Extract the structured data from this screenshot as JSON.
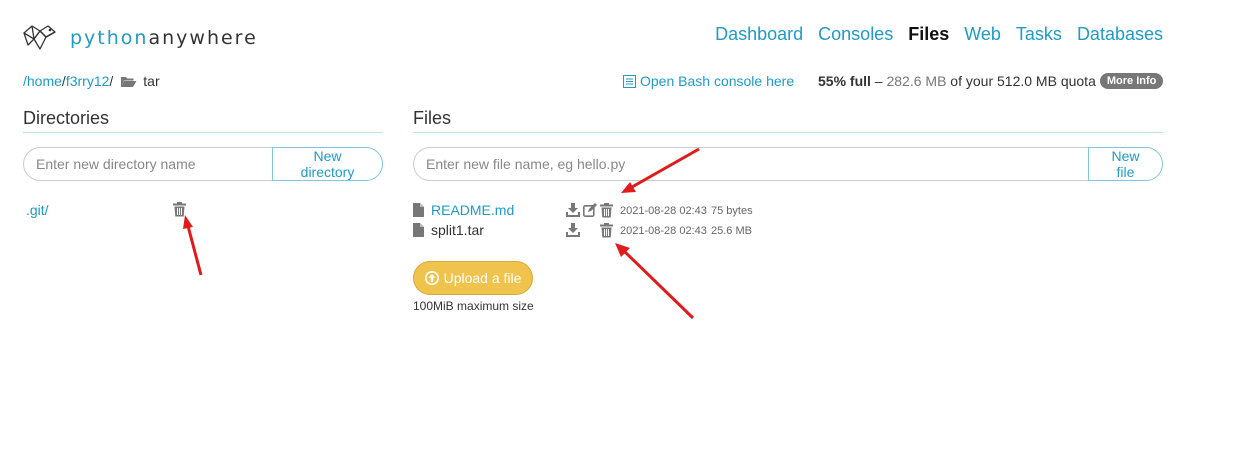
{
  "header": {
    "logo_prefix": "python",
    "logo_suffix": "anywhere",
    "nav": [
      {
        "label": "Dashboard",
        "active": false
      },
      {
        "label": "Consoles",
        "active": false
      },
      {
        "label": "Files",
        "active": true
      },
      {
        "label": "Web",
        "active": false
      },
      {
        "label": "Tasks",
        "active": false
      },
      {
        "label": "Databases",
        "active": false
      }
    ]
  },
  "breadcrumb": {
    "home": "/home",
    "user": "f3rry12",
    "sep": "/",
    "current": "tar"
  },
  "bash_link": "Open Bash console here",
  "quota": {
    "percent": "55% full",
    "dash": " – ",
    "used": "282.6 MB",
    "of_text": " of your 512.0 MB quota",
    "more_info": "More Info"
  },
  "directories": {
    "title": "Directories",
    "input_placeholder": "Enter new directory name",
    "button_label": "New directory",
    "items": [
      ".git/"
    ]
  },
  "files": {
    "title": "Files",
    "input_placeholder": "Enter new file name, eg hello.py",
    "button_label": "New file",
    "items": [
      {
        "name": "README.md",
        "modified": "2021-08-28 02:43",
        "size": "75 bytes",
        "editable": true
      },
      {
        "name": "split1.tar",
        "modified": "2021-08-28 02:43",
        "size": "25.6 MB",
        "editable": false
      }
    ],
    "upload_label": "Upload a file",
    "upload_note": "100MiB maximum size"
  },
  "colors": {
    "link": "#1f9bc6",
    "upload": "#f0c34c",
    "annotation_arrow": "#e01b1b"
  }
}
